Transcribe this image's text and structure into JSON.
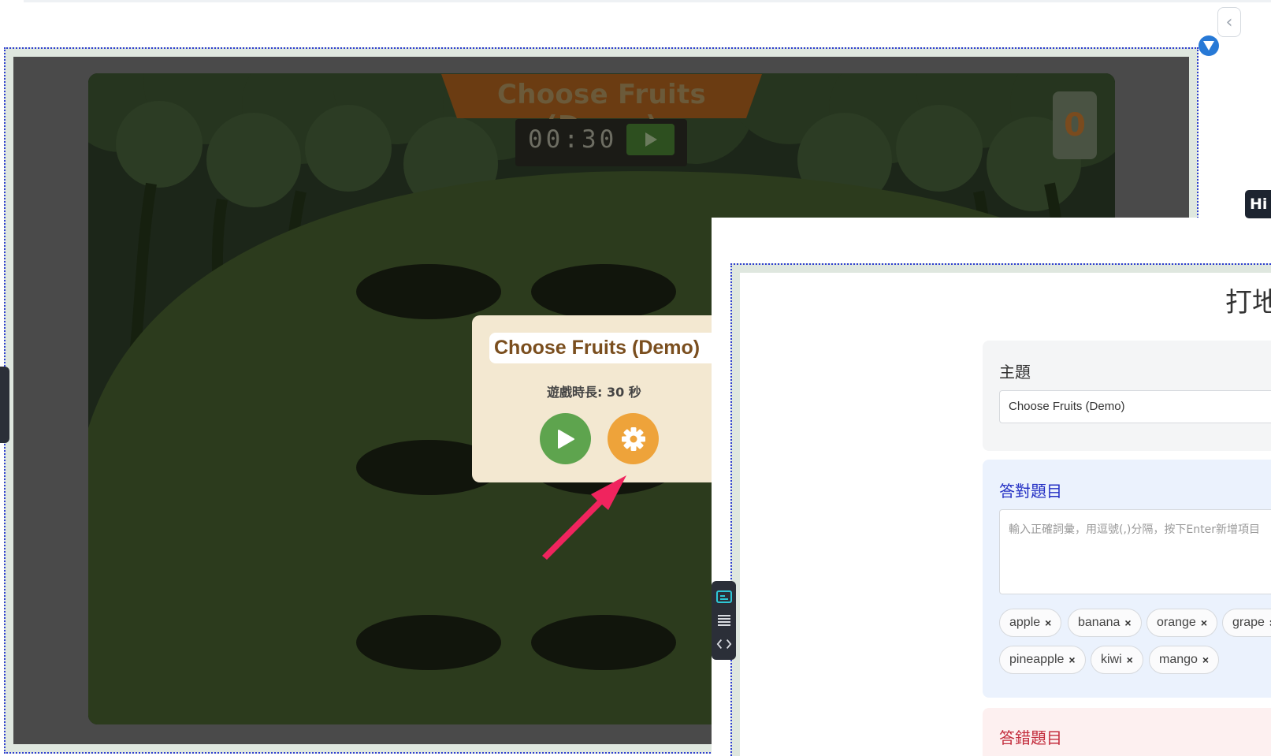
{
  "game": {
    "title": "Choose Fruits (Demo)",
    "timer": "00:30",
    "score": "0"
  },
  "popup": {
    "title": "Choose Fruits (Demo)",
    "duration_label": "遊戲時長:  30 秒"
  },
  "side_badge": {
    "label": "Hi"
  },
  "settings": {
    "heading": "打地",
    "topic": {
      "label": "主題",
      "value": "Choose Fruits (Demo)"
    },
    "correct": {
      "label": "答對題目",
      "placeholder": "輸入正確詞彙，用逗號(,)分隔，按下Enter新增項目",
      "tags": [
        "apple",
        "banana",
        "orange",
        "grape",
        "pineapple",
        "kiwi",
        "mango"
      ]
    },
    "wrong": {
      "label": "答錯題目"
    }
  },
  "colors": {
    "accent_blue": "#2430c4",
    "accent_red": "#c32c3c",
    "play_green": "#5ea44e",
    "settings_orange": "#eea33a",
    "arrow_pink": "#f0245e"
  },
  "icons": {
    "collapse": "chevron-left-icon",
    "dropdown": "triangle-down-icon",
    "play": "play-icon",
    "settings": "gear-icon",
    "pointer": "arrow-icon"
  }
}
